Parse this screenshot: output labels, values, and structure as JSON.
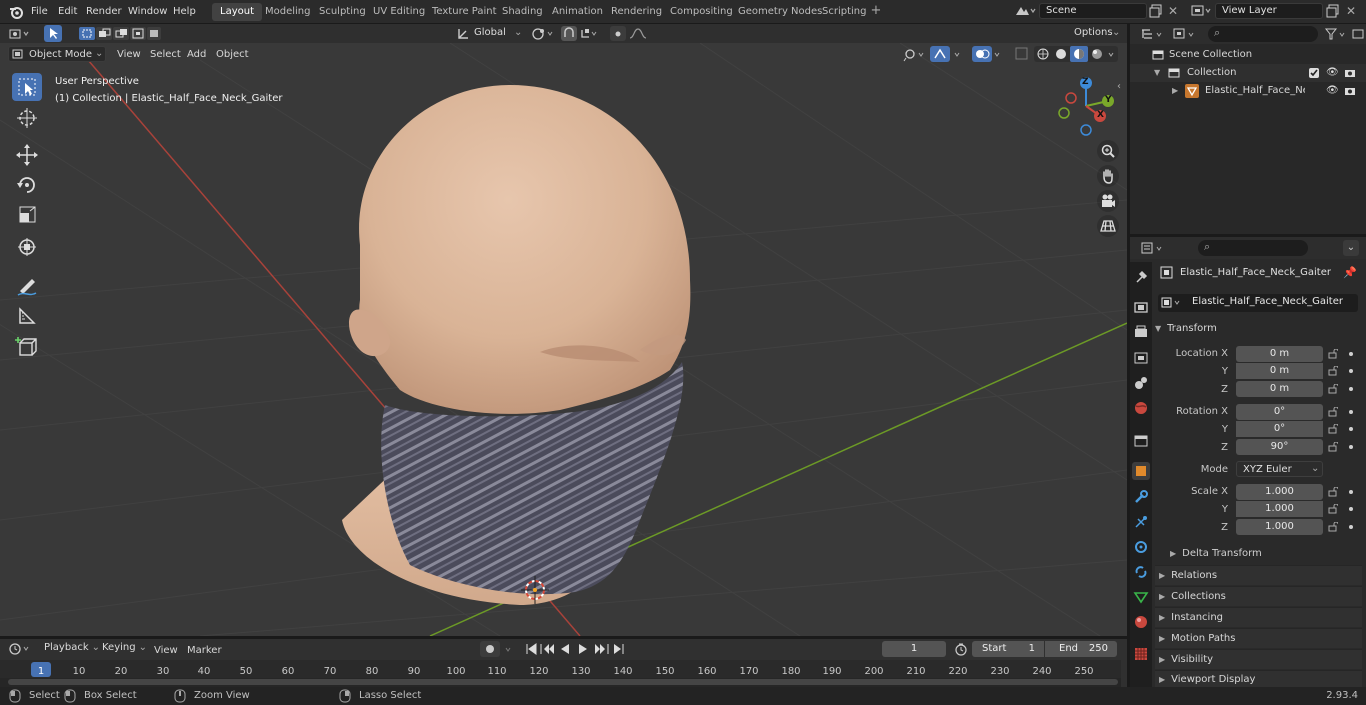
{
  "topbar": {
    "menus": [
      "File",
      "Edit",
      "Render",
      "Window",
      "Help"
    ],
    "workspaces": [
      "Layout",
      "Modeling",
      "Sculpting",
      "UV Editing",
      "Texture Paint",
      "Shading",
      "Animation",
      "Rendering",
      "Compositing",
      "Geometry Nodes",
      "Scripting"
    ],
    "active_workspace": "Layout",
    "scene": "Scene",
    "view_layer": "View Layer"
  },
  "viewport_header": {
    "mode": "Object Mode",
    "menus": [
      "View",
      "Select",
      "Add",
      "Object"
    ],
    "orientation": "Global",
    "options": "Options"
  },
  "viewport": {
    "perspective_label": "User Perspective",
    "object_label": "(1) Collection | Elastic_Half_Face_Neck_Gaiter",
    "gizmo": {
      "x": "X",
      "y": "Y",
      "z": "Z"
    }
  },
  "outliner": {
    "scene_collection": "Scene Collection",
    "collection": "Collection",
    "object": "Elastic_Half_Face_Neck_G"
  },
  "properties": {
    "object_name": "Elastic_Half_Face_Neck_Gaiter",
    "data_name": "Elastic_Half_Face_Neck_Gaiter",
    "transform_label": "Transform",
    "location_label": "Location X",
    "rotation_label": "Rotation X",
    "scale_label": "Scale X",
    "y_label": "Y",
    "z_label": "Z",
    "location": [
      "0 m",
      "0 m",
      "0 m"
    ],
    "rotation": [
      "0°",
      "0°",
      "90°"
    ],
    "mode_label": "Mode",
    "mode_value": "XYZ Euler",
    "scale": [
      "1.000",
      "1.000",
      "1.000"
    ],
    "delta_transform": "Delta Transform",
    "panels": [
      "Relations",
      "Collections",
      "Instancing",
      "Motion Paths",
      "Visibility",
      "Viewport Display"
    ]
  },
  "timeline": {
    "menus": [
      "Playback",
      "Keying",
      "View",
      "Marker"
    ],
    "current_frame": "1",
    "start_label": "Start",
    "start": "1",
    "end_label": "End",
    "end": "250",
    "ticks": [
      "1",
      "10",
      "20",
      "30",
      "40",
      "50",
      "60",
      "70",
      "80",
      "90",
      "100",
      "110",
      "120",
      "130",
      "140",
      "150",
      "160",
      "170",
      "180",
      "190",
      "200",
      "210",
      "220",
      "230",
      "240",
      "250"
    ]
  },
  "statusbar": {
    "select": "Select",
    "box_select": "Box Select",
    "zoom_view": "Zoom View",
    "lasso_select": "Lasso Select",
    "version": "2.93.4"
  },
  "colors": {
    "accent": "#4772b3",
    "viewport_bg": "#393939",
    "x_axis": "#c9483e",
    "y_axis": "#7aa82a",
    "z_axis": "#3d8bd9"
  }
}
